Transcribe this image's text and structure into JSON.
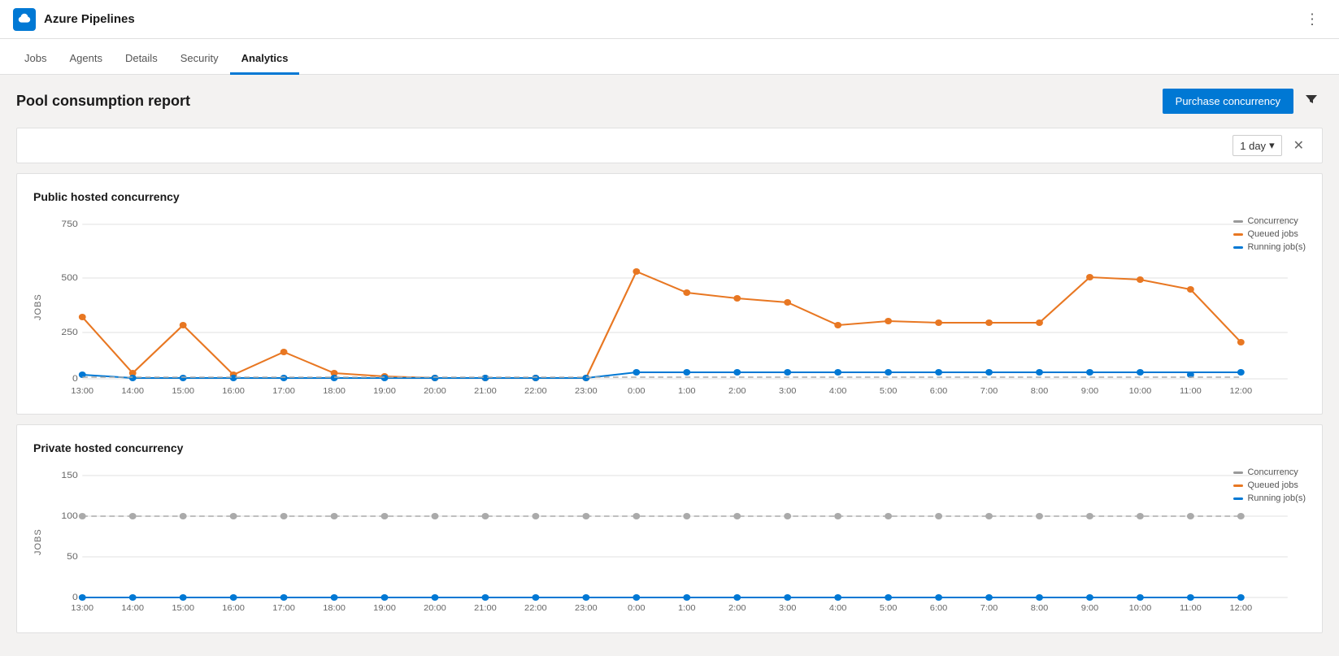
{
  "header": {
    "title": "Azure Pipelines",
    "logo_alt": "Azure Pipelines Logo"
  },
  "nav": {
    "tabs": [
      {
        "id": "jobs",
        "label": "Jobs",
        "active": false
      },
      {
        "id": "agents",
        "label": "Agents",
        "active": false
      },
      {
        "id": "details",
        "label": "Details",
        "active": false
      },
      {
        "id": "security",
        "label": "Security",
        "active": false
      },
      {
        "id": "analytics",
        "label": "Analytics",
        "active": true
      }
    ]
  },
  "page": {
    "title": "Pool consumption report",
    "purchase_button": "Purchase concurrency",
    "filter_period": "1 day"
  },
  "charts": {
    "public": {
      "title": "Public hosted concurrency",
      "y_label": "JOBS",
      "y_max": 750,
      "y_ticks": [
        0,
        250,
        500,
        750
      ],
      "legend": {
        "concurrency": "Concurrency",
        "queued": "Queued jobs",
        "running": "Running job(s)"
      }
    },
    "private": {
      "title": "Private hosted concurrency",
      "y_label": "JOBS",
      "y_max": 150,
      "y_ticks": [
        0,
        50,
        100,
        150
      ],
      "legend": {
        "concurrency": "Concurrency",
        "queued": "Queued jobs",
        "running": "Running job(s)"
      }
    }
  },
  "icons": {
    "more_vertical": "⋮",
    "filter": "▼",
    "chevron_down": "▾",
    "close": "✕"
  }
}
